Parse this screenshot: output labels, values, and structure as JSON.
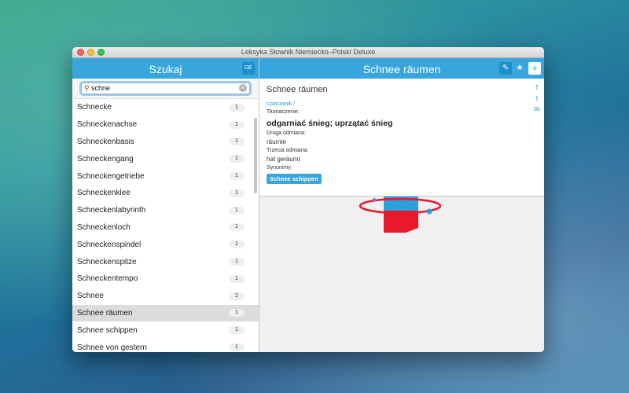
{
  "window": {
    "title": "Leksyka Słownik Niemiecko–Polski Deluxe"
  },
  "left": {
    "header": "Szukaj",
    "lang": "DE",
    "search": {
      "value": "schne"
    },
    "items": [
      {
        "word": "Schnecke",
        "count": "1"
      },
      {
        "word": "Schneckenachse",
        "count": "1"
      },
      {
        "word": "Schneckenbasis",
        "count": "1"
      },
      {
        "word": "Schneckengang",
        "count": "1"
      },
      {
        "word": "Schneckengetriebe",
        "count": "1"
      },
      {
        "word": "Schneckenklee",
        "count": "1"
      },
      {
        "word": "Schneckenlabyrinth",
        "count": "1"
      },
      {
        "word": "Schneckenloch",
        "count": "1"
      },
      {
        "word": "Schneckenspindel",
        "count": "1"
      },
      {
        "word": "Schneckenspitze",
        "count": "1"
      },
      {
        "word": "Schneckentempo",
        "count": "1"
      },
      {
        "word": "Schnee",
        "count": "2"
      },
      {
        "word": "Schnee räumen",
        "count": "1"
      },
      {
        "word": "Schnee schippen",
        "count": "1"
      },
      {
        "word": "Schnee von gestern",
        "count": "1"
      }
    ]
  },
  "right": {
    "header": "Schnee räumen",
    "entry": {
      "headword": "Schnee räumen",
      "pos": "czasownik /",
      "translation_label": "Tłumaczenie:",
      "translation": "odgarniać śnieg; uprzątać śnieg",
      "second_form_label": "Druga odmiana:",
      "second_form": "räumte",
      "third_form_label": "Trzecia odmiana:",
      "third_form": "hat geräumt",
      "synonyms_label": "Synonimy:",
      "synonym": "Schnee schippen"
    },
    "share": {
      "facebook": "f",
      "twitter": "t",
      "mail": "✉"
    },
    "buttons": {
      "edit": "✎",
      "star": "★",
      "add": "+"
    }
  },
  "colors": {
    "accent": "#38a6dd",
    "graphic_red": "#e8192c",
    "graphic_blue": "#2f9fd8"
  }
}
